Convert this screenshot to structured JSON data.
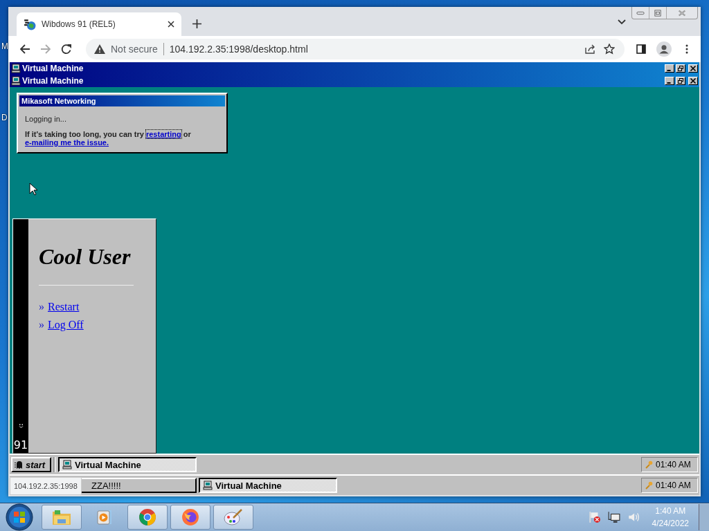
{
  "desktop": {
    "icon_labels": [
      "M",
      "D"
    ]
  },
  "browser": {
    "tabs": [
      {
        "title": "Wibdows 91 (REL5)",
        "selected": true
      }
    ],
    "security": "Not secure",
    "url": "104.192.2.35:1998/desktop.html",
    "status_tooltip": "104.192.2.35:1998"
  },
  "page": {
    "windows": [
      {
        "title": "Virtual Machine"
      },
      {
        "title": "Virtual Machine"
      }
    ],
    "dialog": {
      "title": "Mikasoft Networking",
      "message": "Logging in...",
      "help": "If it's taking too long, you can try",
      "link_restart": "restarting",
      "joiner": "or",
      "link_email": "e-mailing me the issue."
    },
    "start_menu": {
      "side_label": "91",
      "user": "Cool User",
      "items": [
        {
          "bullet": "»",
          "label": "Restart"
        },
        {
          "bullet": "»",
          "label": "Log Off"
        }
      ]
    },
    "taskbars": [
      {
        "start": "start",
        "tasks": [
          {
            "label": "Virtual Machine",
            "selected": true,
            "icon": true
          }
        ],
        "clock": "01:40 AM"
      },
      {
        "tasks": [
          {
            "label": "ZZA!!!!!",
            "selected": false,
            "icon": false
          },
          {
            "label": "Virtual Machine",
            "selected": true,
            "icon": true
          }
        ],
        "clock": "01:40 AM"
      }
    ]
  },
  "os_taskbar": {
    "pinned": [
      {
        "kind": "folder",
        "running": true
      },
      {
        "kind": "media",
        "running": false
      },
      {
        "kind": "chrome",
        "running": true
      },
      {
        "kind": "firefox",
        "running": true
      },
      {
        "kind": "paint",
        "running": true
      }
    ],
    "time": "1:40 AM",
    "date": "4/24/2022"
  }
}
